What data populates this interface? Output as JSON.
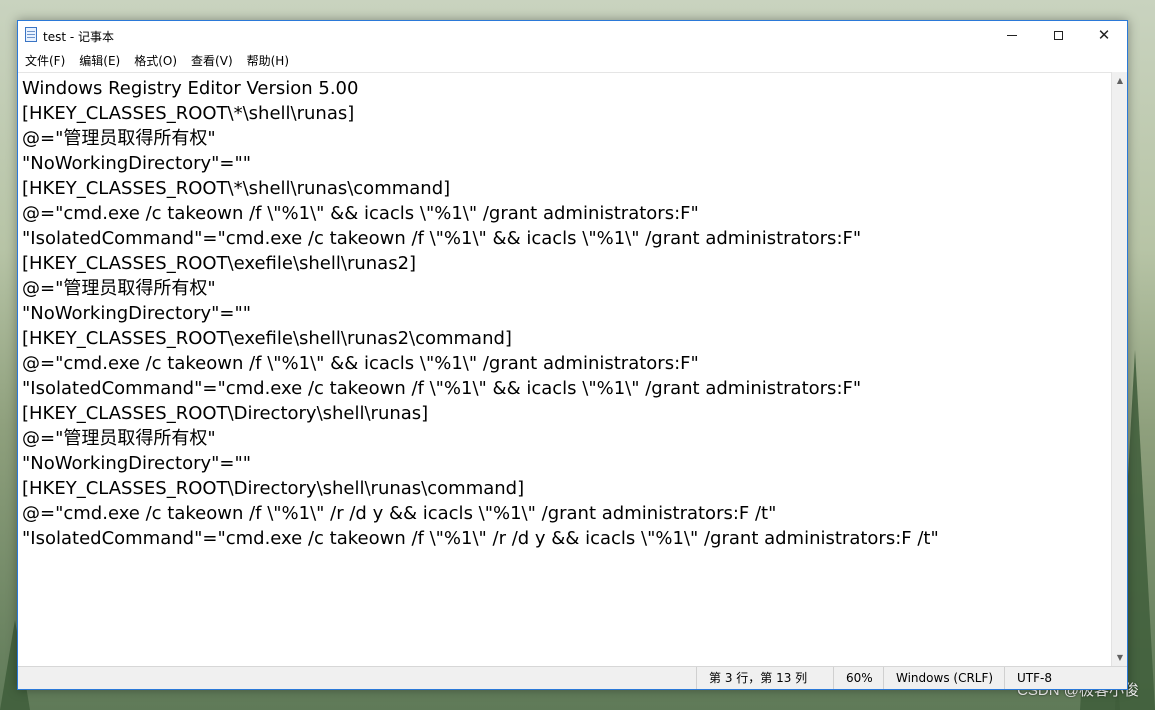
{
  "window": {
    "title": "test - 记事本",
    "close_glyph": "✕"
  },
  "menu": {
    "items": [
      "文件(F)",
      "编辑(E)",
      "格式(O)",
      "查看(V)",
      "帮助(H)"
    ]
  },
  "editor": {
    "lines": [
      "Windows Registry Editor Version 5.00",
      "[HKEY_CLASSES_ROOT\\*\\shell\\runas]",
      "@=\"管理员取得所有权\"",
      "\"NoWorkingDirectory\"=\"\"",
      "[HKEY_CLASSES_ROOT\\*\\shell\\runas\\command]",
      "@=\"cmd.exe /c takeown /f \\\"%1\\\" && icacls \\\"%1\\\" /grant administrators:F\"",
      "\"IsolatedCommand\"=\"cmd.exe /c takeown /f \\\"%1\\\" && icacls \\\"%1\\\" /grant administrators:F\"",
      "[HKEY_CLASSES_ROOT\\exefile\\shell\\runas2]",
      "@=\"管理员取得所有权\"",
      "\"NoWorkingDirectory\"=\"\"",
      "[HKEY_CLASSES_ROOT\\exefile\\shell\\runas2\\command]",
      "@=\"cmd.exe /c takeown /f \\\"%1\\\" && icacls \\\"%1\\\" /grant administrators:F\"",
      "\"IsolatedCommand\"=\"cmd.exe /c takeown /f \\\"%1\\\" && icacls \\\"%1\\\" /grant administrators:F\"",
      "[HKEY_CLASSES_ROOT\\Directory\\shell\\runas]",
      "@=\"管理员取得所有权\"",
      "\"NoWorkingDirectory\"=\"\"",
      "[HKEY_CLASSES_ROOT\\Directory\\shell\\runas\\command]",
      "@=\"cmd.exe /c takeown /f \\\"%1\\\" /r /d y && icacls \\\"%1\\\" /grant administrators:F /t\"",
      "\"IsolatedCommand\"=\"cmd.exe /c takeown /f \\\"%1\\\" /r /d y && icacls \\\"%1\\\" /grant administrators:F /t\""
    ]
  },
  "status": {
    "position": "第 3 行，第 13 列",
    "zoom": "60%",
    "line_ending": "Windows (CRLF)",
    "encoding": "UTF-8"
  },
  "desktop": {
    "watermark": "CSDN @极客小俊"
  },
  "colors": {
    "window_border": "#2b79d8",
    "status_bar": "#f0f0f0"
  }
}
